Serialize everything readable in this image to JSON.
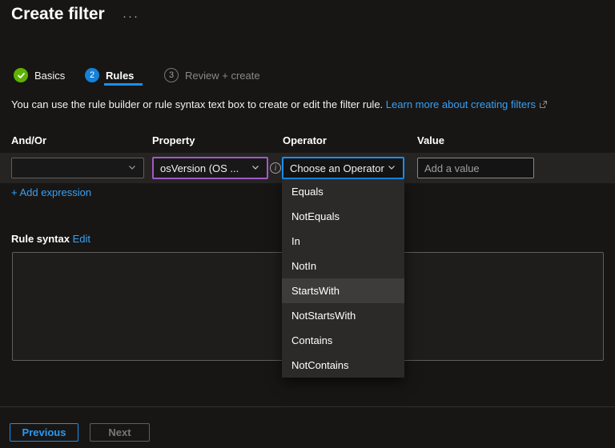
{
  "page": {
    "title": "Create filter",
    "more_options_glyph": "···"
  },
  "steps": [
    {
      "label": "Basics",
      "state": "complete"
    },
    {
      "label": "Rules",
      "number": "2",
      "state": "current"
    },
    {
      "label": "Review + create",
      "number": "3",
      "state": "upcoming"
    }
  ],
  "description": {
    "text": "You can use the rule builder or rule syntax text box to create or edit the filter rule.",
    "link_text": "Learn more about creating filters"
  },
  "rule_builder": {
    "columns": [
      "And/Or",
      "Property",
      "Operator",
      "Value"
    ],
    "row": {
      "and_or_value": "",
      "property_value": "osVersion (OS ...",
      "operator_placeholder": "Choose an Operator",
      "value_placeholder": "Add a value"
    },
    "add_expression_label": "+ Add expression"
  },
  "operator_menu": {
    "items": [
      "Equals",
      "NotEquals",
      "In",
      "NotIn",
      "StartsWith",
      "NotStartsWith",
      "Contains",
      "NotContains"
    ],
    "highlighted": "StartsWith"
  },
  "rule_syntax": {
    "label": "Rule syntax",
    "edit_label": "Edit",
    "content": ""
  },
  "footer": {
    "previous_label": "Previous",
    "next_label": "Next"
  },
  "icons": {
    "check_glyph": "✓",
    "info_glyph": "i"
  },
  "colors": {
    "background": "#171615",
    "row_background": "#252423",
    "accent_blue": "#1890f1",
    "link_blue": "#3aa0f3",
    "success_green": "#5db300",
    "property_border_purple": "#a05ac8",
    "menu_background": "#2b2a29",
    "menu_highlight": "#3d3c3b"
  }
}
